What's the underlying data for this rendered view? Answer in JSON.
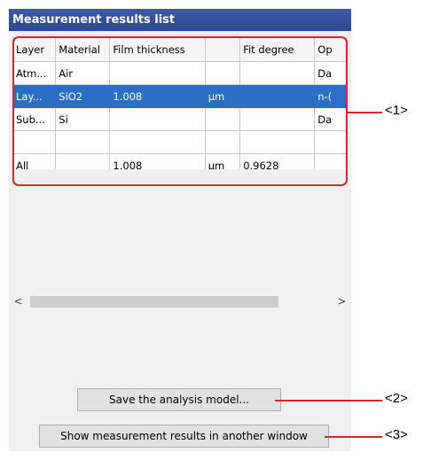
{
  "panel": {
    "title": "Measurement results list"
  },
  "table": {
    "headers": [
      "Layer",
      "Material",
      "Film thickness",
      "",
      "Fit degree",
      "Op"
    ],
    "rows": [
      [
        "Atm...",
        "Air",
        "",
        "",
        "",
        "Da"
      ],
      [
        "Lay...",
        "SiO2",
        "1.008",
        "µm",
        "",
        "n-("
      ],
      [
        "Sub...",
        "Si",
        "",
        "",
        "",
        "Da"
      ],
      [
        "",
        "",
        "",
        "",
        "",
        ""
      ],
      [
        "All",
        "",
        "1.008",
        "µm",
        "0.9628",
        ""
      ]
    ],
    "selected_row": 1
  },
  "scrollbar": {
    "left_arrow": "<",
    "right_arrow": ">"
  },
  "buttons": {
    "save_model": "Save the analysis model...",
    "show_results": "Show measurement results in another window"
  },
  "callouts": [
    "<1>",
    "<2>",
    "<3>"
  ],
  "colors": {
    "header_bg": "#2d4791",
    "selection": "#2a6fc4",
    "callout": "#d9232d"
  }
}
